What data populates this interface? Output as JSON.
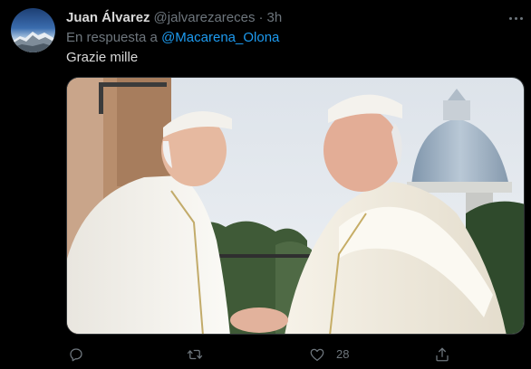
{
  "tweet": {
    "author": {
      "display_name": "Juan Álvarez",
      "handle": "@jalvarezareces"
    },
    "separator": "·",
    "timestamp": "3h",
    "reply_prefix": "En respuesta a",
    "reply_to": "@Macarena_Olona",
    "text": "Grazie mille",
    "media": {
      "description": "Photo"
    },
    "actions": {
      "reply_count": "",
      "retweet_count": "",
      "like_count": "28"
    }
  },
  "colors": {
    "background": "#000000",
    "text_primary": "#d9d9d9",
    "text_secondary": "#6e767d",
    "link": "#1d9bf0"
  },
  "icons": [
    "avatar",
    "more-icon",
    "reply-icon",
    "retweet-icon",
    "like-icon",
    "share-icon"
  ]
}
